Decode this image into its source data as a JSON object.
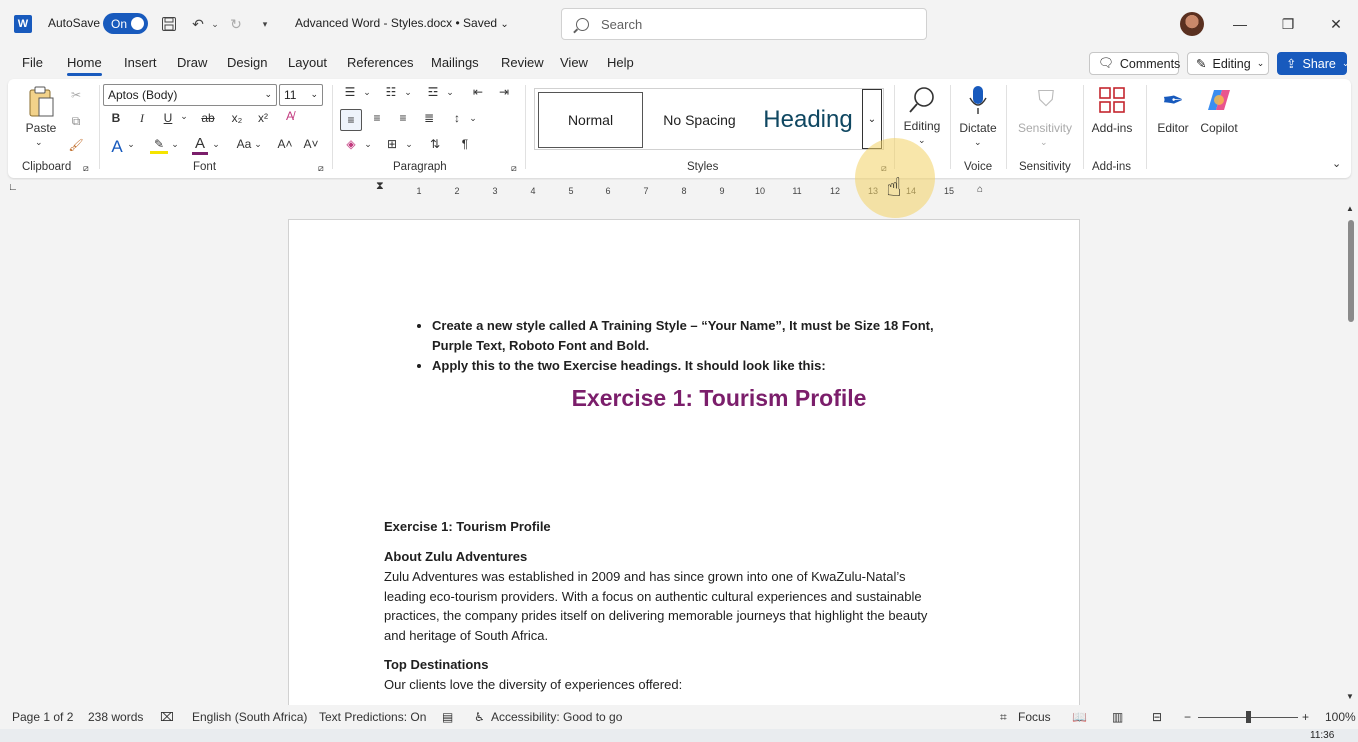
{
  "titlebar": {
    "app_icon": "W",
    "autosave_label": "AutoSave",
    "autosave_state": "On",
    "doc_title": "Advanced Word - Styles.docx • Saved",
    "search_placeholder": "Search"
  },
  "menu": {
    "tabs": [
      "File",
      "Home",
      "Insert",
      "Draw",
      "Design",
      "Layout",
      "References",
      "Mailings",
      "Review",
      "View",
      "Help"
    ],
    "active_tab": "Home",
    "comments_label": "Comments",
    "editing_label": "Editing",
    "share_label": "Share"
  },
  "ribbon": {
    "paste_label": "Paste",
    "font_name": "Aptos (Body)",
    "font_size": "11",
    "styles": {
      "normal": "Normal",
      "no_spacing": "No Spacing",
      "heading": "Heading"
    },
    "editing_label": "Editing",
    "dictate_label": "Dictate",
    "sensitivity_label": "Sensitivity",
    "addins_label": "Add-ins",
    "editor_label": "Editor",
    "copilot_label": "Copilot",
    "groups": {
      "clipboard": "Clipboard",
      "font": "Font",
      "paragraph": "Paragraph",
      "styles": "Styles",
      "voice": "Voice",
      "sensitivity": "Sensitivity",
      "addins": "Add-ins"
    }
  },
  "ruler": {
    "numbers": [
      "1",
      "2",
      "3",
      "4",
      "5",
      "6",
      "7",
      "8",
      "9",
      "10",
      "11",
      "12",
      "13",
      "14",
      "15"
    ]
  },
  "document": {
    "bullet_1a": "Create a new style called A Training Style – “Your Name”, It must be Size 18 Font,",
    "bullet_1b": "Purple Text, Roboto Font and Bold.",
    "bullet_2": "Apply this to the two Exercise headings. It should look like this:",
    "exercise_heading": "Exercise 1: Tourism Profile",
    "heading_plain": "Exercise 1: Tourism Profile",
    "about_title": "About Zulu Adventures",
    "about_line1": "Zulu Adventures was established in 2009 and has since grown into one of KwaZulu-Natal’s",
    "about_line2": "leading eco-tourism providers. With a focus on authentic cultural experiences and sustainable",
    "about_line3": "practices, the company prides itself on delivering memorable journeys that highlight the beauty",
    "about_line4": "and heritage of South Africa.",
    "destinations_title": "Top Destinations",
    "destinations_text": "Our clients love the diversity of experiences offered:"
  },
  "statusbar": {
    "page": "Page 1 of 2",
    "words": "238 words",
    "language": "English (South Africa)",
    "predictions": "Text Predictions: On",
    "accessibility": "Accessibility: Good to go",
    "focus": "Focus",
    "zoom": "100%"
  },
  "taskbar": {
    "time": "11:36"
  },
  "colors": {
    "accent": "#185abd",
    "purple_heading": "#7b1e6b"
  }
}
